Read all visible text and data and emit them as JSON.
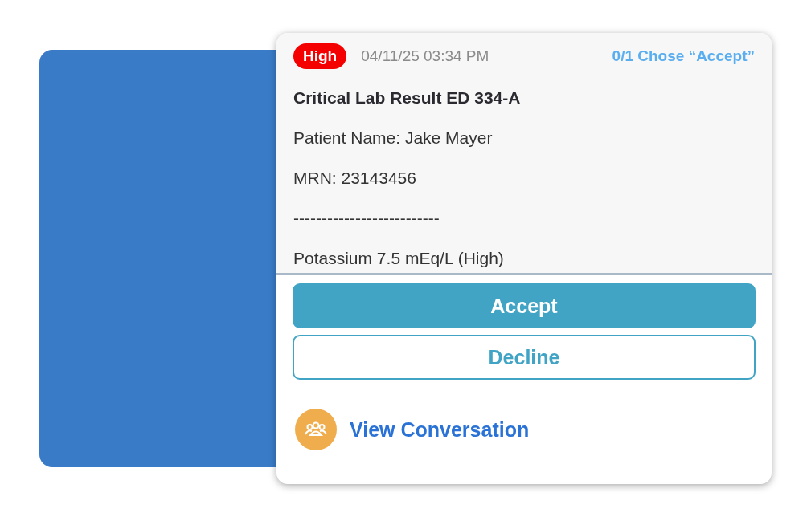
{
  "alert": {
    "priority": "High",
    "timestamp": "04/11/25 03:34 PM",
    "response_status": "0/1 Chose “Accept”",
    "title": "Critical Lab Result ED 334-A",
    "lines": [
      "Patient Name: Jake Mayer",
      "MRN: 23143456",
      "--------------------------",
      "Potassium 7.5 mEq/L (High)"
    ],
    "buttons": [
      {
        "label": "Accept",
        "kind": "primary"
      },
      {
        "label": "Decline",
        "kind": "secondary"
      }
    ],
    "link": "View Conversation"
  }
}
